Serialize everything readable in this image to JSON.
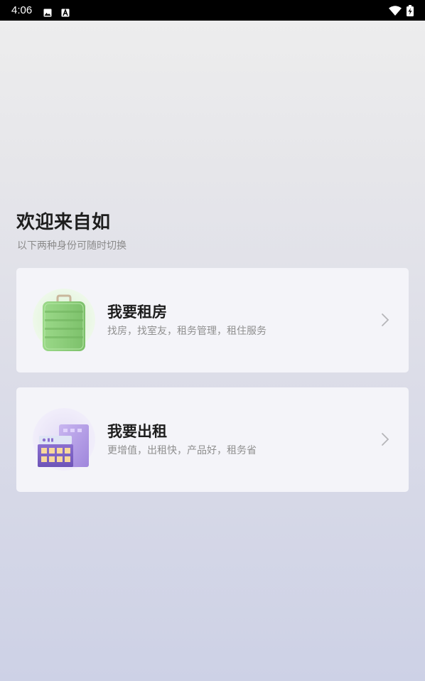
{
  "status_bar": {
    "time": "4:06",
    "left_icons": [
      "image-icon",
      "a-icon"
    ],
    "right_icons": [
      "wifi-icon",
      "battery-charging-icon"
    ]
  },
  "welcome": {
    "title": "欢迎来自如",
    "subtitle": "以下两种身份可随时切换"
  },
  "cards": [
    {
      "title": "我要租房",
      "description": "找房，找室友，租务管理，租住服务",
      "icon": "suitcase-icon",
      "accent": "#8fcf7a"
    },
    {
      "title": "我要出租",
      "description": "更增值，出租快，产品好，租务省",
      "icon": "buildings-icon",
      "accent": "#9b86d8"
    }
  ],
  "colors": {
    "status_bar": "#000000",
    "card_background": "#f4f4f9",
    "title_text": "#1e1e1e",
    "secondary_text": "#8a8a8a",
    "chevron": "#b5b5b9"
  }
}
